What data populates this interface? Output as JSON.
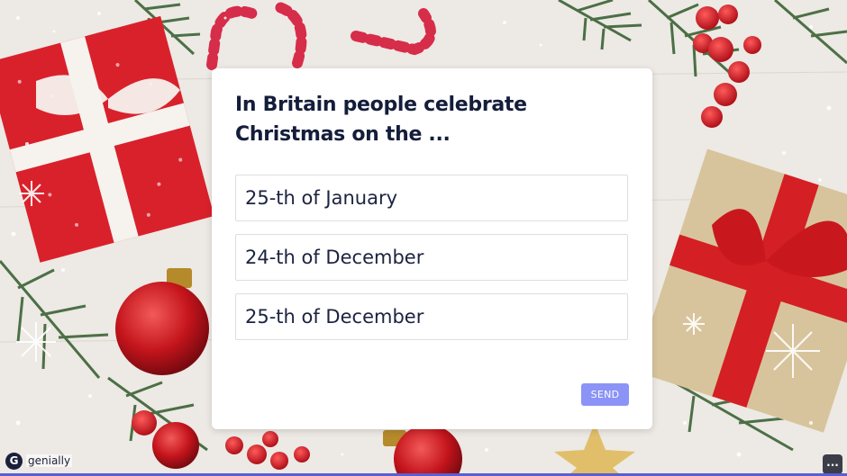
{
  "quiz": {
    "question": "In Britain people celebrate Christmas on the ...",
    "options": [
      {
        "label": "25-th of January"
      },
      {
        "label": "24-th of December"
      },
      {
        "label": "25-th of December"
      }
    ],
    "send_label": "SEND"
  },
  "branding": {
    "logo_letter": "G",
    "logo_text": "genially"
  },
  "controls": {
    "menu_label": "..."
  },
  "colors": {
    "send_button": "#8b93f6",
    "title_text": "#141d3a",
    "progress_bar": "#5a5fcf"
  }
}
